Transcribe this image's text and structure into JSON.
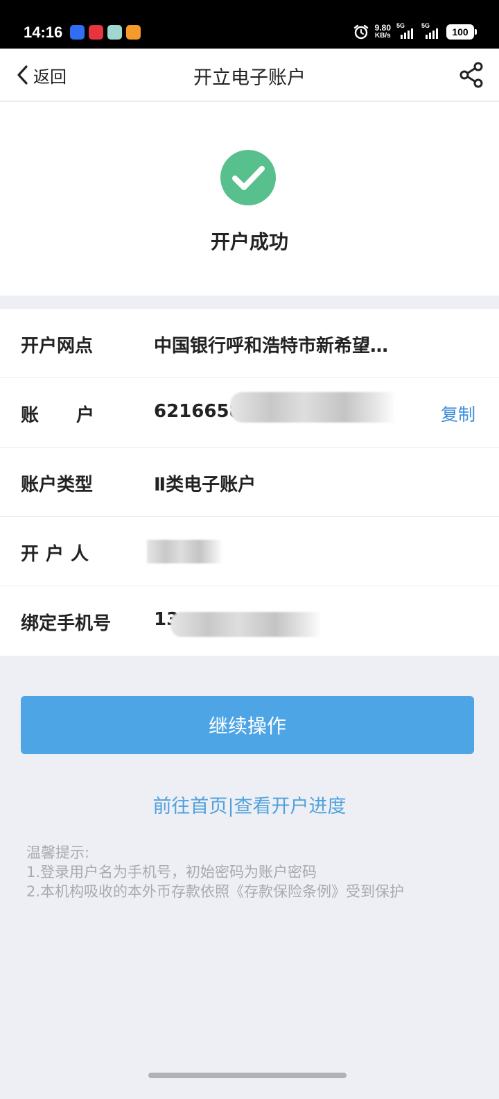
{
  "status_bar": {
    "time": "14:16",
    "net_speed_value": "9.80",
    "net_speed_unit": "KB/s",
    "signal_1_label": "5G",
    "signal_2_label": "5G",
    "battery": "100",
    "app_colors": [
      "#2f6ef5",
      "#e8343f",
      "#9fd8d0",
      "#f59a2b"
    ]
  },
  "nav": {
    "back_label": "返回",
    "title": "开立电子账户"
  },
  "success": {
    "title": "开户成功",
    "icon_color": "#57c08d"
  },
  "info": {
    "branch_label": "开户网点",
    "branch_value": "中国银行呼和浩特市新希望…",
    "account_label": "账户",
    "account_value": "6216658",
    "copy_label": "复制",
    "type_label": "账户类型",
    "type_value": "Ⅱ类电子账户",
    "holder_label": "开户人",
    "phone_label": "绑定手机号",
    "phone_value": "13"
  },
  "actions": {
    "continue_label": "继续操作",
    "home_link": "前往首页",
    "separator": "|",
    "progress_link": "查看开户进度"
  },
  "tips": {
    "heading": "温馨提示:",
    "line1": "1.登录用户名为手机号，初始密码为账户密码",
    "line2": "2.本机构吸收的本外币存款依照《存款保险条例》受到保护"
  },
  "colors": {
    "accent": "#4ea5e6",
    "link": "#4fa2dc",
    "copy": "#3f8fd8"
  }
}
